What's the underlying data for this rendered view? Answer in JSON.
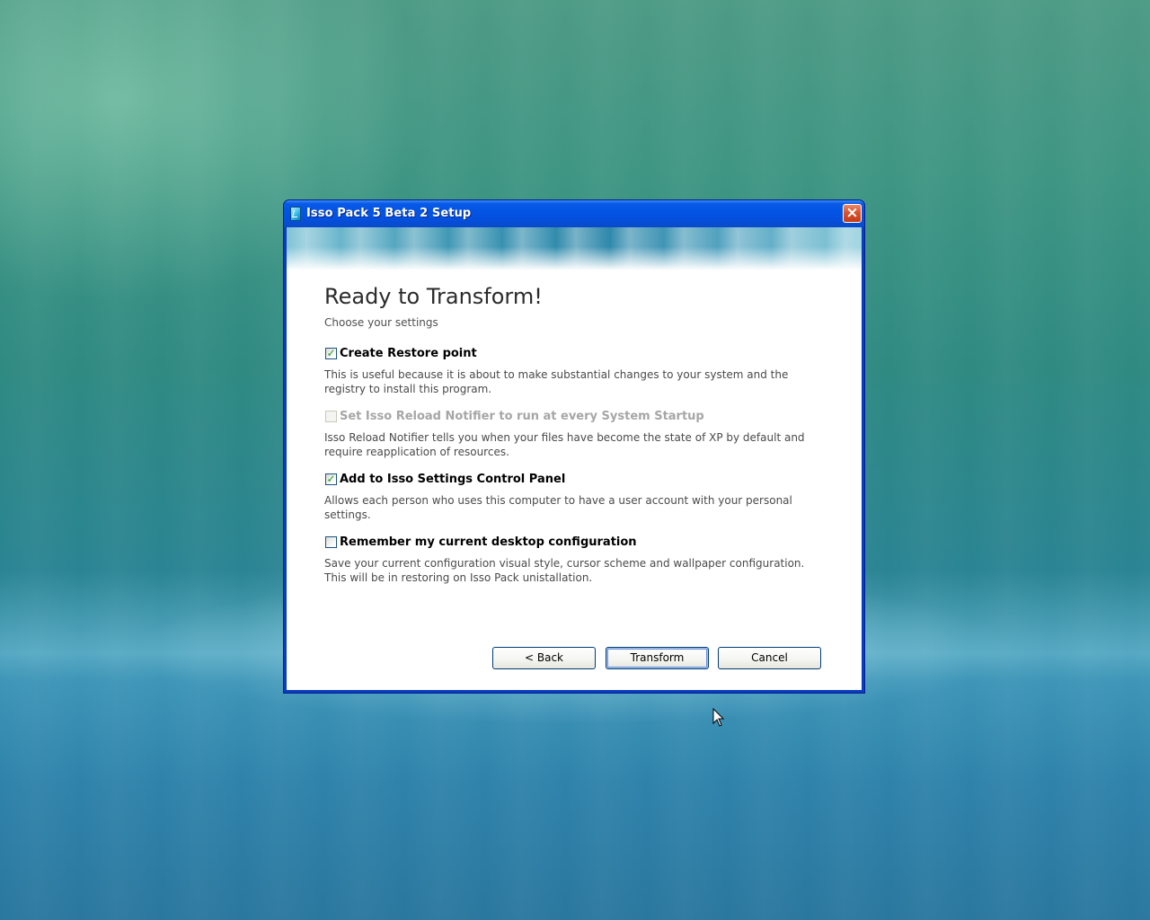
{
  "window": {
    "title": "Isso Pack 5 Beta 2 Setup",
    "close_glyph": "×"
  },
  "page": {
    "title": "Ready to Transform!",
    "subtitle": "Choose your settings"
  },
  "options": [
    {
      "label": "Create Restore point",
      "checked": true,
      "enabled": true,
      "check_glyph": "✓",
      "description": "This is useful because it is about to make substantial changes to your system and the registry to install this program."
    },
    {
      "label": "Set Isso Reload Notifier to run at every System Startup",
      "checked": false,
      "enabled": false,
      "check_glyph": "",
      "description": "Isso Reload Notifier tells you when your files have become the state of XP by default and require reapplication of resources."
    },
    {
      "label": "Add to Isso Settings Control Panel",
      "checked": true,
      "enabled": true,
      "check_glyph": "✓",
      "description": "Allows each person who uses this computer to have a user account with your personal settings."
    },
    {
      "label": "Remember my current desktop configuration",
      "checked": false,
      "enabled": true,
      "check_glyph": "",
      "description": "Save your current configuration visual style, cursor scheme and wallpaper configuration. This will be in restoring on Isso Pack unistallation."
    }
  ],
  "buttons": {
    "back": "< Back",
    "transform": "Transform",
    "cancel": "Cancel"
  },
  "icons": {
    "app": "setup-app-icon",
    "close": "close-icon",
    "cursor": "mouse-pointer-icon"
  },
  "colors": {
    "titlebar": "#0454e3",
    "window_border": "#0a3cc2",
    "close_button": "#d8532f",
    "checkmark": "#21a121",
    "disabled_text": "#a6a6a6"
  }
}
